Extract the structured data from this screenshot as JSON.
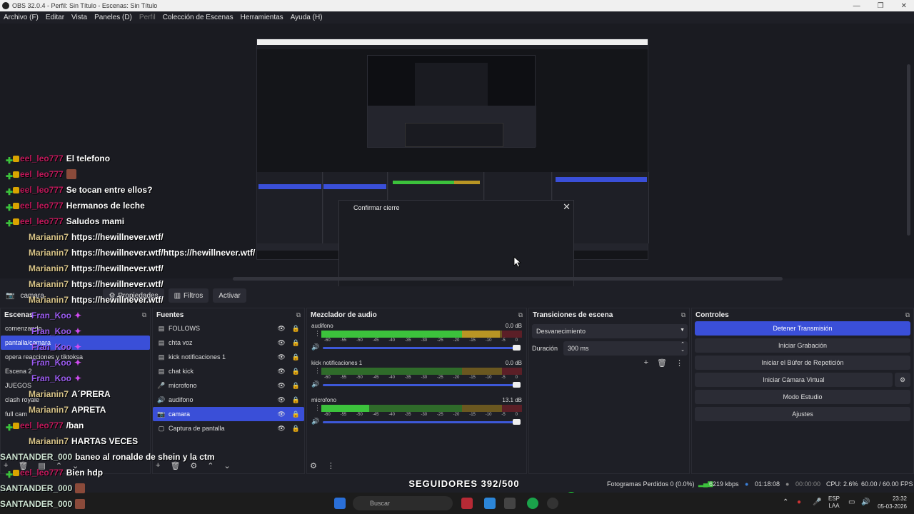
{
  "window": {
    "title": "OBS 32.0.4 - Perfil: Sin Título - Escenas: Sin Título",
    "controls": [
      "—",
      "❐",
      "✕"
    ]
  },
  "menu": [
    "Archivo (F)",
    "Editar",
    "Vista",
    "Paneles (D)",
    "Perfil",
    "Colección de Escenas",
    "Herramientas",
    "Ayuda (H)"
  ],
  "dialog": {
    "title": "Confirmar cierre",
    "close": "✕"
  },
  "source_bar": {
    "selected": "camara",
    "properties": "Propiedades",
    "filters": "Filtros",
    "activate": "Activar"
  },
  "scenes": {
    "title": "Escenas",
    "items": [
      "comenzando",
      "pantalla/camara",
      "opera reacciones y tiktoksa",
      "Escena 2",
      "JUEGOS",
      "clash royale",
      "full cam"
    ]
  },
  "sources": {
    "title": "Fuentes",
    "items": [
      {
        "icon": "▤",
        "name": "FOLLOWS"
      },
      {
        "icon": "▤",
        "name": "chta voz"
      },
      {
        "icon": "▤",
        "name": "kick notificaciones 1"
      },
      {
        "icon": "▤",
        "name": "chat kick"
      },
      {
        "icon": "🎤",
        "name": "microfono"
      },
      {
        "icon": "🔊",
        "name": "audifono"
      },
      {
        "icon": "📷",
        "name": "camara"
      },
      {
        "icon": "▢",
        "name": "Captura de pantalla"
      }
    ]
  },
  "mixer": {
    "title": "Mezclador de audio",
    "channels": [
      {
        "name": "audifono",
        "db": "0.0 dB",
        "level": 0.89
      },
      {
        "name": "kick notificaciones 1",
        "db": "0.0 dB",
        "level": 0
      },
      {
        "name": "microfono",
        "db": "13.1 dB",
        "level": 0.24
      }
    ],
    "ticks": [
      "-60",
      "-55",
      "-50",
      "-45",
      "-40",
      "-35",
      "-30",
      "-25",
      "-20",
      "-15",
      "-10",
      "-5",
      "0"
    ]
  },
  "transitions": {
    "title": "Transiciones de escena",
    "type": "Desvanecimiento",
    "duration_label": "Duración",
    "duration": "300 ms"
  },
  "controls": {
    "title": "Controles",
    "buttons": [
      "Detener Transmisión",
      "Iniciar Grabación",
      "Iniciar el Búfer de Repetición",
      "Iniciar Cámara Virtual",
      "Modo Estudio",
      "Ajustes"
    ]
  },
  "chat": [
    {
      "name": "eel_leo777",
      "msg": "El telefono",
      "color": "#c2185b"
    },
    {
      "name": "eel_leo777",
      "msg": "",
      "color": "#c2185b"
    },
    {
      "name": "eel_leo777",
      "msg": "Se tocan entre ellos?",
      "color": "#c2185b"
    },
    {
      "name": "eel_leo777",
      "msg": "Hermanos de leche",
      "color": "#c2185b"
    },
    {
      "name": "eel_leo777",
      "msg": "Saludos mami",
      "color": "#c2185b"
    },
    {
      "name": "Marianin7",
      "msg": "https://hewillnever.wtf/",
      "color": "#d8c489"
    },
    {
      "name": "Marianin7",
      "msg": "https://hewillnever.wtf/https://hewillnever.wtf/",
      "color": "#d8c489"
    },
    {
      "name": "Marianin7",
      "msg": "https://hewillnever.wtf/",
      "color": "#d8c489"
    },
    {
      "name": "Marianin7",
      "msg": "https://hewillnever.wtf/",
      "color": "#d8c489"
    },
    {
      "name": "Marianin7",
      "msg": "https://hewillnever.wtf/",
      "color": "#d8c489"
    },
    {
      "name": "Fran_Koo",
      "msg": "",
      "color": "#9c5cf2"
    },
    {
      "name": "Fran_Koo",
      "msg": "",
      "color": "#9c5cf2"
    },
    {
      "name": "Fran_Koo",
      "msg": "",
      "color": "#9c5cf2"
    },
    {
      "name": "Fran_Koo",
      "msg": "",
      "color": "#9c5cf2"
    },
    {
      "name": "Fran_Koo",
      "msg": "",
      "color": "#9c5cf2"
    },
    {
      "name": "Marianin7",
      "msg": "A´PRERA",
      "color": "#d8c489"
    },
    {
      "name": "Marianin7",
      "msg": "APRETA",
      "color": "#d8c489"
    },
    {
      "name": "eel_leo777",
      "msg": "/ban",
      "color": "#c2185b"
    },
    {
      "name": "Marianin7",
      "msg": "HARTAS VECES",
      "color": "#d8c489"
    },
    {
      "name": "SANTANDER_000",
      "msg": "baneo al ronalde de shein y la ctm",
      "color": "#cde3d2"
    },
    {
      "name": "eel_leo777",
      "msg": "Bien hdp",
      "color": "#c2185b"
    },
    {
      "name": "SANTANDER_000",
      "msg": "",
      "color": "#cde3d2"
    },
    {
      "name": "SANTANDER_000",
      "msg": "",
      "color": "#cde3d2"
    }
  ],
  "followers": {
    "label": "SEGUIDORES 392/500",
    "progress": 0.784
  },
  "status": {
    "dropped": "Fotogramas Perdidos 0 (0.0%)",
    "kbps": "6219 kbps",
    "stream_time": "01:18:08",
    "rec_time": "00:00:00",
    "cpu": "CPU: 2.6%",
    "fps": "60.00 / 60.00 FPS"
  },
  "taskbar": {
    "search": "Buscar",
    "lang": "ESP",
    "lang2": "LAA",
    "time": "23:32",
    "date": "05-03-2026"
  },
  "colors": {
    "accent": "#3a4fd8",
    "bg": "#1e1f26"
  }
}
